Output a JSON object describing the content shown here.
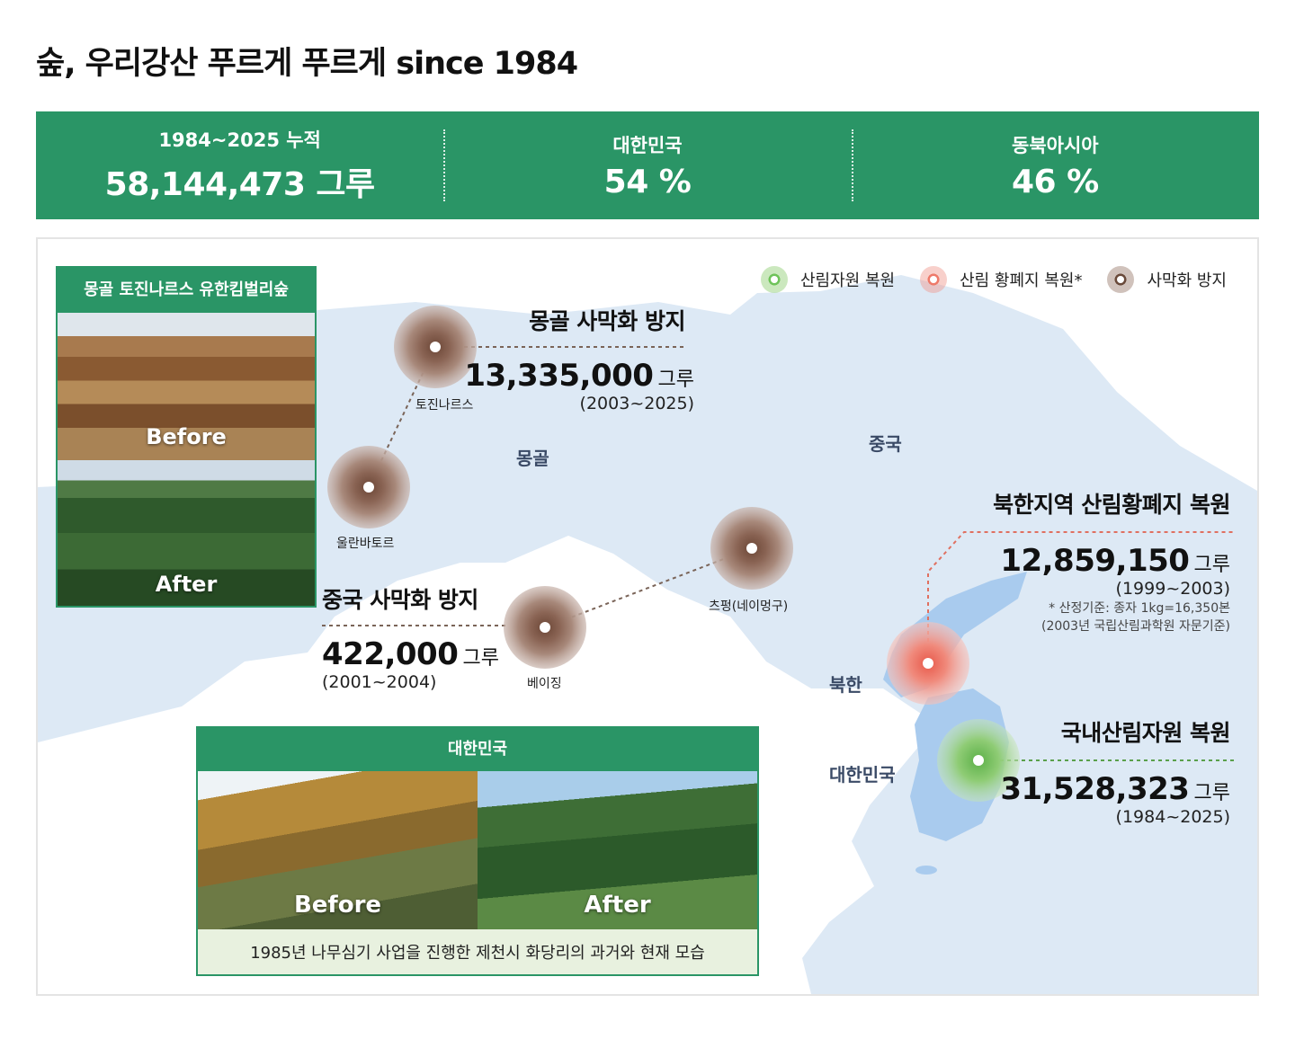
{
  "page_title": "숲, 우리강산 푸르게 푸르게 since 1984",
  "stats": [
    {
      "label": "1984~2025 누적",
      "value": "58,144,473 그루"
    },
    {
      "label": "대한민국",
      "value": "54 %"
    },
    {
      "label": "동북아시아",
      "value": "46 %"
    }
  ],
  "legend": [
    {
      "label": "산림자원 복원",
      "color": "#6fc35a"
    },
    {
      "label": "산림 황폐지 복원*",
      "color": "#ee7a6a"
    },
    {
      "label": "사막화 방지",
      "color": "#6a4a3a"
    }
  ],
  "mongolia_photo": {
    "title": "몽골 토진나르스 유한킴벌리숲",
    "before": "Before",
    "after": "After"
  },
  "korea_photo": {
    "title": "대한민국",
    "before": "Before",
    "after": "After",
    "caption": "1985년 나무심기 사업을 진행한 제천시 화당리의 과거와 현재 모습"
  },
  "callouts": {
    "mongolia": {
      "title": "몽골 사막화 방지",
      "number": "13,335,000",
      "unit": "그루",
      "period": "(2003~2025)"
    },
    "china": {
      "title": "중국 사막화 방지",
      "number": "422,000",
      "unit": "그루",
      "period": "(2001~2004)"
    },
    "north_korea": {
      "title": "북한지역 산림황폐지 복원",
      "number": "12,859,150",
      "unit": "그루",
      "period": "(1999~2003)",
      "note1": "* 산정기준: 종자 1kg=16,350본",
      "note2": "(2003년 국립산림과학원 자문기준)"
    },
    "south_korea": {
      "title": "국내산림자원 복원",
      "number": "31,528,323",
      "unit": "그루",
      "period": "(1984~2025)"
    }
  },
  "map_labels": {
    "mongolia": "몽골",
    "china": "중국",
    "north_korea": "북한",
    "south_korea": "대한민국"
  },
  "site_labels": {
    "tojinnars": "토진나르스",
    "ulaanbaatar": "울란바토르",
    "beijing": "베이징",
    "chifeng": "츠펑(네이멍구)"
  },
  "colors": {
    "brand_green": "#2a9566",
    "land": "#dde9f5",
    "korea": "#a9cbee",
    "caption_bg": "#e8f1df"
  }
}
